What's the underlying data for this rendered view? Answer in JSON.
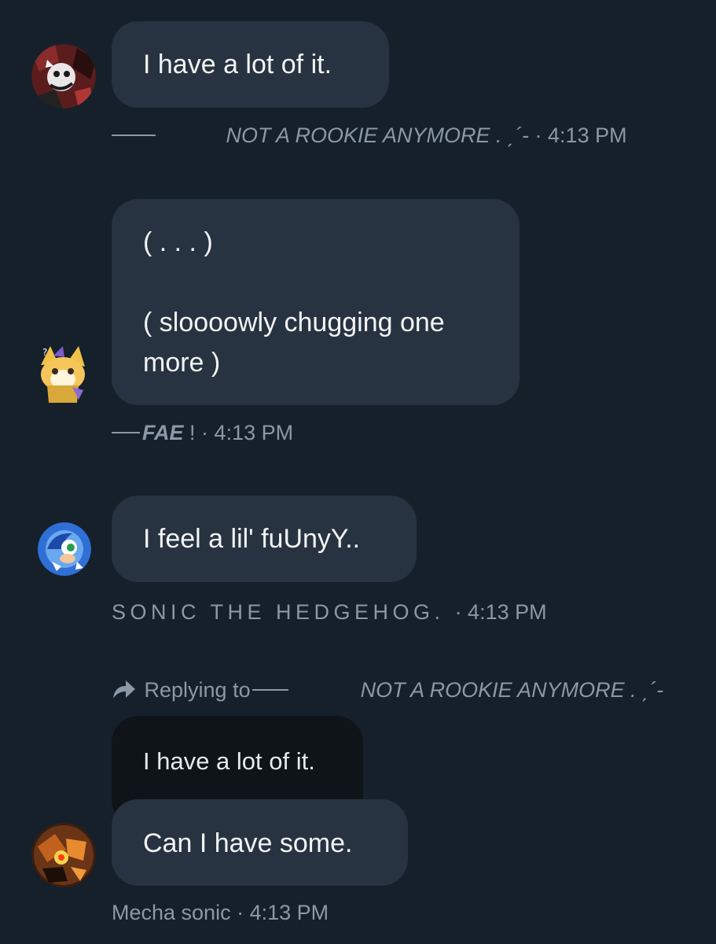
{
  "messages": [
    {
      "text": "I have a lot of it.",
      "author": "NOT A ROOKIE ANYMORE . ˏ´-",
      "time": "· 4:13 PM"
    },
    {
      "lines": [
        "( .   .   . )",
        "",
        "( sloooowly chugging one",
        "more )"
      ],
      "author": "FAE",
      "author_suffix": "! ·",
      "time": "4:13 PM"
    },
    {
      "text": "I feel a lil' fuUnyY..",
      "author": "SONIC THE HEDGEHOG.",
      "time": "· 4:13 PM"
    },
    {
      "reply_label": "Replying to",
      "reply_to": "NOT A ROOKIE ANYMORE . ˏ´-",
      "quoted_text": "I have a lot of it.",
      "text": "Can I have some.",
      "author": "Mecha sonic",
      "time": "· 4:13 PM"
    }
  ],
  "icons": {
    "avatar_1": "avatar-red-black-cartoon-icon",
    "avatar_2": "avatar-yellow-fox-icon",
    "avatar_3": "avatar-blue-sonic-icon",
    "avatar_4": "avatar-orange-robot-icon",
    "reply": "reply-arrow-icon"
  },
  "colors": {
    "background": "#15202b",
    "bubble": "#273340",
    "quoted_bubble": "#0f1419",
    "meta_text": "#8b98a5",
    "bubble_text": "#f2f4f5"
  }
}
